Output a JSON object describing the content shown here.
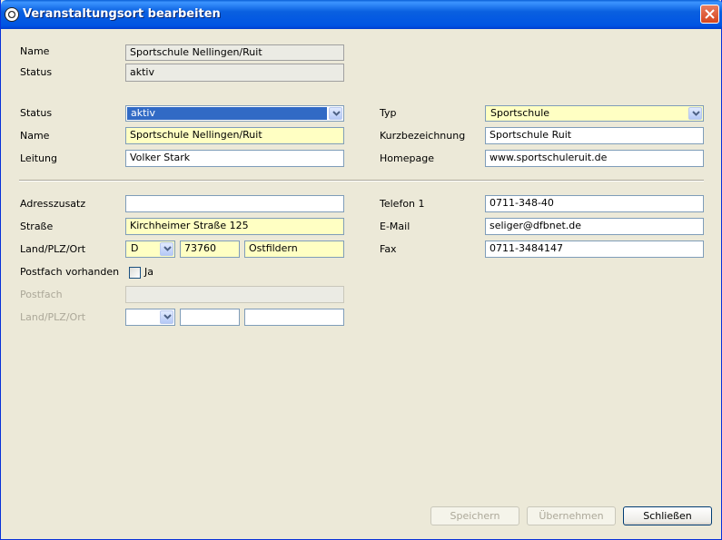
{
  "window": {
    "title": "Veranstaltungsort bearbeiten",
    "icon": "soccer-ball-icon",
    "close_icon": "close-icon"
  },
  "header_section": {
    "name_label": "Name",
    "name_value": "Sportschule Nellingen/Ruit",
    "status_label": "Status",
    "status_value": "aktiv"
  },
  "form": {
    "status_label": "Status",
    "status_value": "aktiv",
    "typ_label": "Typ",
    "typ_value": "Sportschule",
    "name_label": "Name",
    "name_value": "Sportschule Nellingen/Ruit",
    "kurz_label": "Kurzbezeichnung",
    "kurz_value": "Sportschule Ruit",
    "leitung_label": "Leitung",
    "leitung_value": "Volker Stark",
    "homepage_label": "Homepage",
    "homepage_value": "www.sportschuleruit.de"
  },
  "address": {
    "zusatz_label": "Adresszusatz",
    "zusatz_value": "",
    "strasse_label": "Straße",
    "strasse_value": "Kirchheimer Straße 125",
    "land_label": "Land/PLZ/Ort",
    "land_value": "D",
    "plz_value": "73760",
    "ort_value": "Ostfildern",
    "postfach_vorhanden_label": "Postfach vorhanden",
    "postfach_checkbox_label": "Ja",
    "postfach_checked": false,
    "postfach_label": "Postfach",
    "postfach_value": "",
    "pf_land_label": "Land/PLZ/Ort",
    "pf_land_value": "",
    "pf_plz_value": "",
    "pf_ort_value": ""
  },
  "contact": {
    "telefon_label": "Telefon 1",
    "telefon_value": "0711-348-40",
    "email_label": "E-Mail",
    "email_value": "seliger@dfbnet.de",
    "fax_label": "Fax",
    "fax_value": "0711-3484147"
  },
  "buttons": {
    "save": "Speichern",
    "apply": "Übernehmen",
    "close": "Schließen"
  },
  "colors": {
    "required_field": "#ffffc3",
    "selection": "#316ac5",
    "dialog_bg": "#ece9d8",
    "titlebar": "#0054e3"
  }
}
